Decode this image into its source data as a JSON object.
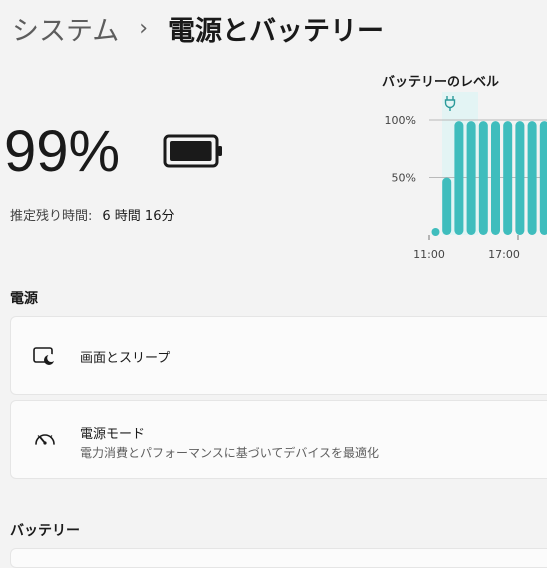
{
  "breadcrumb": {
    "parent": "システム",
    "separator": "›",
    "current": "電源とバッテリー"
  },
  "battery": {
    "percent": "99%",
    "level": 0.99,
    "remaining_label": "推定残り時間:",
    "remaining_value": "6 時間 16分"
  },
  "chart_data": {
    "type": "bar",
    "title": "バッテリーのレベル",
    "y_ticks": [
      "100%",
      "50%"
    ],
    "x_ticks": [
      "11:00",
      "17:00"
    ],
    "ylim": [
      0,
      100
    ],
    "values": [
      2,
      50,
      99,
      99,
      99,
      99,
      99,
      99,
      99,
      99,
      99,
      99
    ],
    "charging_marker": "plug-icon",
    "color": "#3fbdbd"
  },
  "sections": {
    "power": {
      "label": "電源",
      "items": [
        {
          "title": "画面とスリープ",
          "icon": "screen-sleep-icon"
        },
        {
          "title": "電源モード",
          "subtitle": "電力消費とパフォーマンスに基づいてデバイスを最適化",
          "icon": "power-mode-gauge-icon"
        }
      ]
    },
    "battery": {
      "label": "バッテリー"
    }
  }
}
